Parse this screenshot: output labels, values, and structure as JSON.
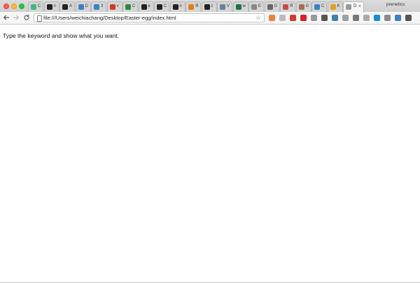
{
  "window": {
    "controls": [
      "close",
      "minimize",
      "maximize"
    ]
  },
  "tabs": [
    {
      "title": "C",
      "icon": "vue-icon",
      "color": "#41b883"
    },
    {
      "title": "n",
      "icon": "github-icon",
      "color": "#222222"
    },
    {
      "title": "A",
      "icon": "github-icon",
      "color": "#222222"
    },
    {
      "title": "D",
      "icon": "globe-icon",
      "color": "#3b82c4"
    },
    {
      "title": "3",
      "icon": "globe-icon",
      "color": "#3b82c4"
    },
    {
      "title": "v",
      "icon": "box-icon",
      "color": "#d0392b"
    },
    {
      "title": "C",
      "icon": "dino-icon",
      "color": "#2d8a3e"
    },
    {
      "title": "e",
      "icon": "github-icon",
      "color": "#222222"
    },
    {
      "title": "C",
      "icon": "github-icon",
      "color": "#222222"
    },
    {
      "title": "n",
      "icon": "github-icon",
      "color": "#222222"
    },
    {
      "title": "Я",
      "icon": "orange-icon",
      "color": "#e57c1f"
    },
    {
      "title": "c",
      "icon": "github-icon",
      "color": "#222222"
    },
    {
      "title": "V",
      "icon": "doc-icon",
      "color": "#6c7ea1"
    },
    {
      "title": "w",
      "icon": "grid-icon",
      "color": "#1f6f4a"
    },
    {
      "title": "E",
      "icon": "window-icon",
      "color": "#888888"
    },
    {
      "title": "G",
      "icon": "translate-icon",
      "color": "#666666"
    },
    {
      "title": "Я",
      "icon": "leaf-icon",
      "color": "#c44d4d"
    },
    {
      "title": "G",
      "icon": "avatar-icon",
      "color": "#a07050"
    },
    {
      "title": "C",
      "icon": "code-icon",
      "color": "#3b82c4"
    },
    {
      "title": "K",
      "icon": "star-icon",
      "color": "#e0a020"
    },
    {
      "title": "D",
      "icon": "page-icon",
      "color": "#9a9a9a",
      "active": true
    }
  ],
  "profile_name": "prenetics",
  "toolbar": {
    "url": "file:///Users/weichiachang/Desktop/Easter-egg/index.html"
  },
  "extensions": [
    {
      "icon": "fox-icon",
      "color": "#e8833a"
    },
    {
      "icon": "rss-icon",
      "color": "#bbbbbb"
    },
    {
      "icon": "cube-icon",
      "color": "#d23b2b"
    },
    {
      "icon": "opera-icon",
      "color": "#d81f26"
    },
    {
      "icon": "hex-icon",
      "color": "#9a9a9a"
    },
    {
      "icon": "person-icon",
      "color": "#555555"
    },
    {
      "icon": "vue-icon",
      "color": "#3f7fb0"
    },
    {
      "icon": "info-icon",
      "color": "#a0a0a0"
    },
    {
      "icon": "a-icon",
      "color": "#777777"
    },
    {
      "icon": "box-icon",
      "color": "#aaaaaa"
    },
    {
      "icon": "s-icon",
      "color": "#1a8cd8"
    },
    {
      "icon": "circle-icon",
      "color": "#8a8a8a"
    },
    {
      "icon": "world-icon",
      "color": "#3b82c4"
    },
    {
      "icon": "menu-icon",
      "color": "#555555"
    }
  ],
  "page": {
    "message": "Type the keyword and show what you want."
  }
}
